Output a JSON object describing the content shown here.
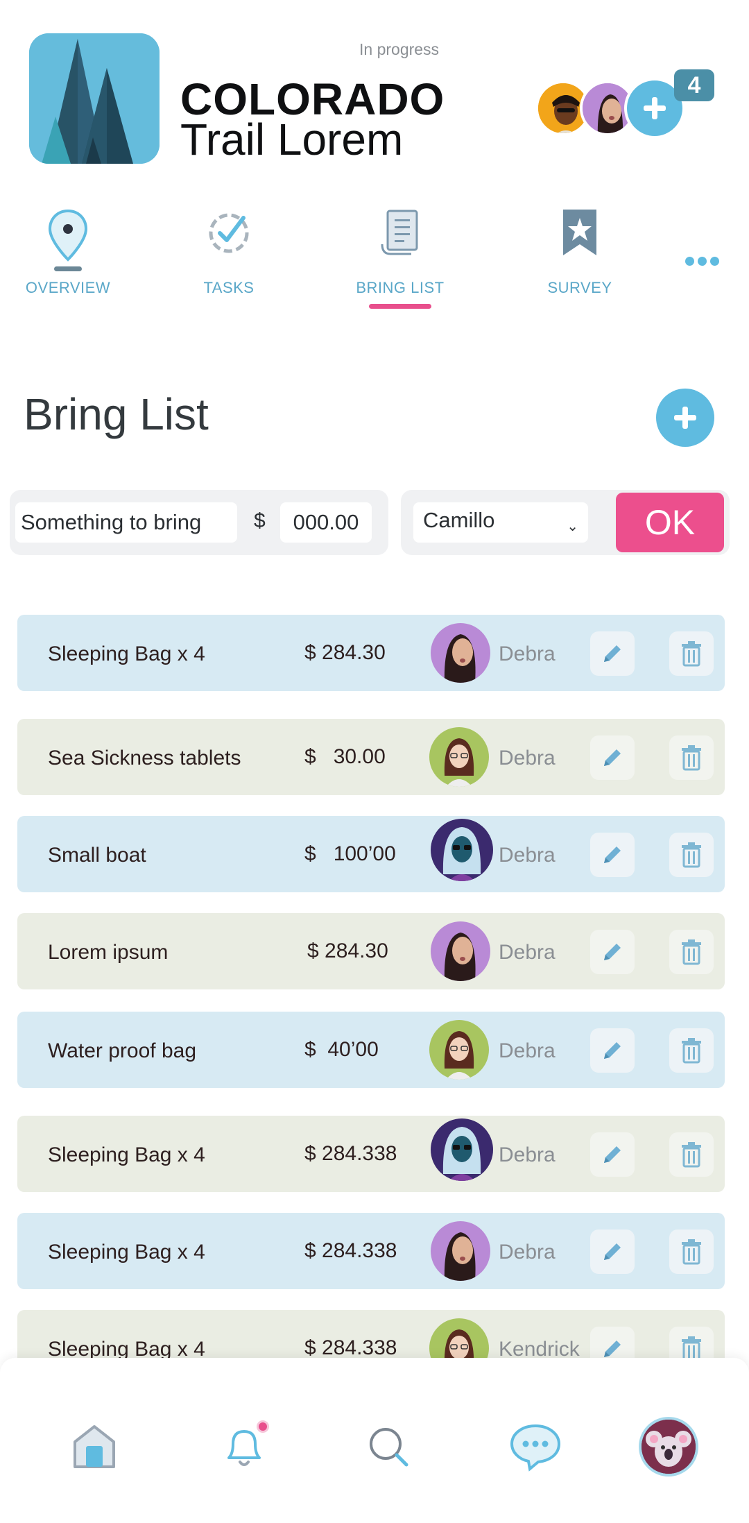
{
  "header": {
    "status": "In progress",
    "title_line1": "COLORADO",
    "title_line2": "Trail Lorem",
    "member_count": "4"
  },
  "tabs": [
    {
      "label": "OVERVIEW",
      "icon": "map-pin-icon",
      "active": false
    },
    {
      "label": "TASKS",
      "icon": "check-circle-icon",
      "active": false
    },
    {
      "label": "BRING LIST",
      "icon": "document-list-icon",
      "active": true
    },
    {
      "label": "SURVEY",
      "icon": "star-bookmark-icon",
      "active": false
    }
  ],
  "section": {
    "title": "Bring List"
  },
  "form": {
    "item_placeholder": "Something to bring",
    "currency": "$",
    "price_placeholder": "000.00",
    "person": "Camillo",
    "ok_label": "OK"
  },
  "items": [
    {
      "name": "Sleeping Bag x 4",
      "price": "$ 284.30",
      "person": "Debra",
      "avatar": "woman-purple",
      "color": "blue"
    },
    {
      "name": "Sea Sickness tablets",
      "price": "$   30.00",
      "person": "Debra",
      "avatar": "woman-green",
      "color": "green"
    },
    {
      "name": "Small boat",
      "price": "$   100’00",
      "person": "Debra",
      "avatar": "woman-navy",
      "color": "blue"
    },
    {
      "name": "Lorem ipsum",
      "price": "$ 284.30",
      "person": "Debra",
      "avatar": "woman-purple",
      "color": "green"
    },
    {
      "name": "Water proof bag",
      "price": "$  40’00",
      "person": "Debra",
      "avatar": "woman-green",
      "color": "blue"
    },
    {
      "name": "Sleeping Bag x 4",
      "price": "$ 284.338",
      "person": "Debra",
      "avatar": "woman-navy",
      "color": "green"
    },
    {
      "name": "Sleeping Bag x 4",
      "price": "$ 284.338",
      "person": "Debra",
      "avatar": "woman-purple",
      "color": "blue"
    },
    {
      "name": "Sleeping Bag x 4",
      "price": "$ 284.338",
      "person": "Kendrick",
      "avatar": "woman-green",
      "color": "green"
    }
  ],
  "bottom_nav": [
    {
      "icon": "home-icon"
    },
    {
      "icon": "bell-icon",
      "badge": true
    },
    {
      "icon": "search-icon"
    },
    {
      "icon": "chat-icon"
    },
    {
      "icon": "koala-avatar-icon"
    }
  ],
  "colors": {
    "accent_blue": "#5fbbe0",
    "accent_pink": "#ec4f8d",
    "row_blue": "#d7eaf3",
    "row_green": "#eaede3"
  }
}
